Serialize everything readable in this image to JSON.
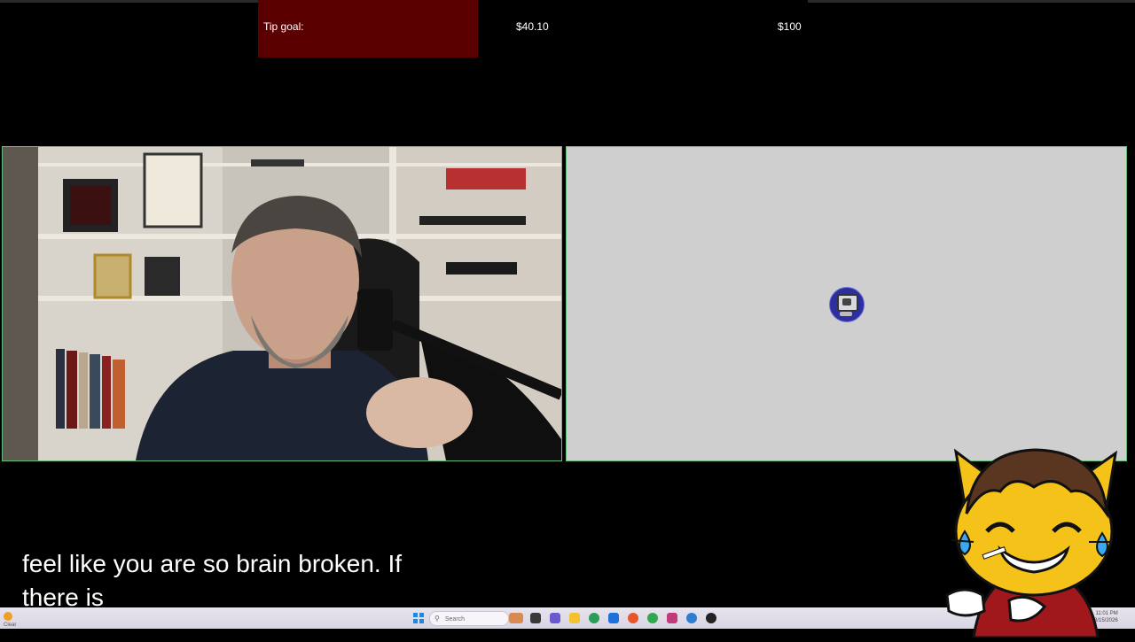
{
  "tip_goal": {
    "label": "Tip goal:",
    "current": "$40.10",
    "target": "$100",
    "colors": {
      "bar": "#5a0000"
    }
  },
  "panels": {
    "webcam": {
      "description_icon": "webcam-feed"
    },
    "screen_share": {
      "icon": "computer-monitor-icon"
    }
  },
  "caption": {
    "line1": "feel like you are so brain broken. If",
    "line2": "there is"
  },
  "taskbar": {
    "search_placeholder": "Search",
    "weather": "Clear",
    "clock_time": "11:01 PM",
    "clock_date": "8/15/2026"
  },
  "colors": {
    "panel_border": "#5fbf7a",
    "screen_bg": "#cfcfcf",
    "mascot_yellow": "#f5c21a",
    "mascot_hair": "#5a3520",
    "mascot_shirt": "#a0181c"
  }
}
